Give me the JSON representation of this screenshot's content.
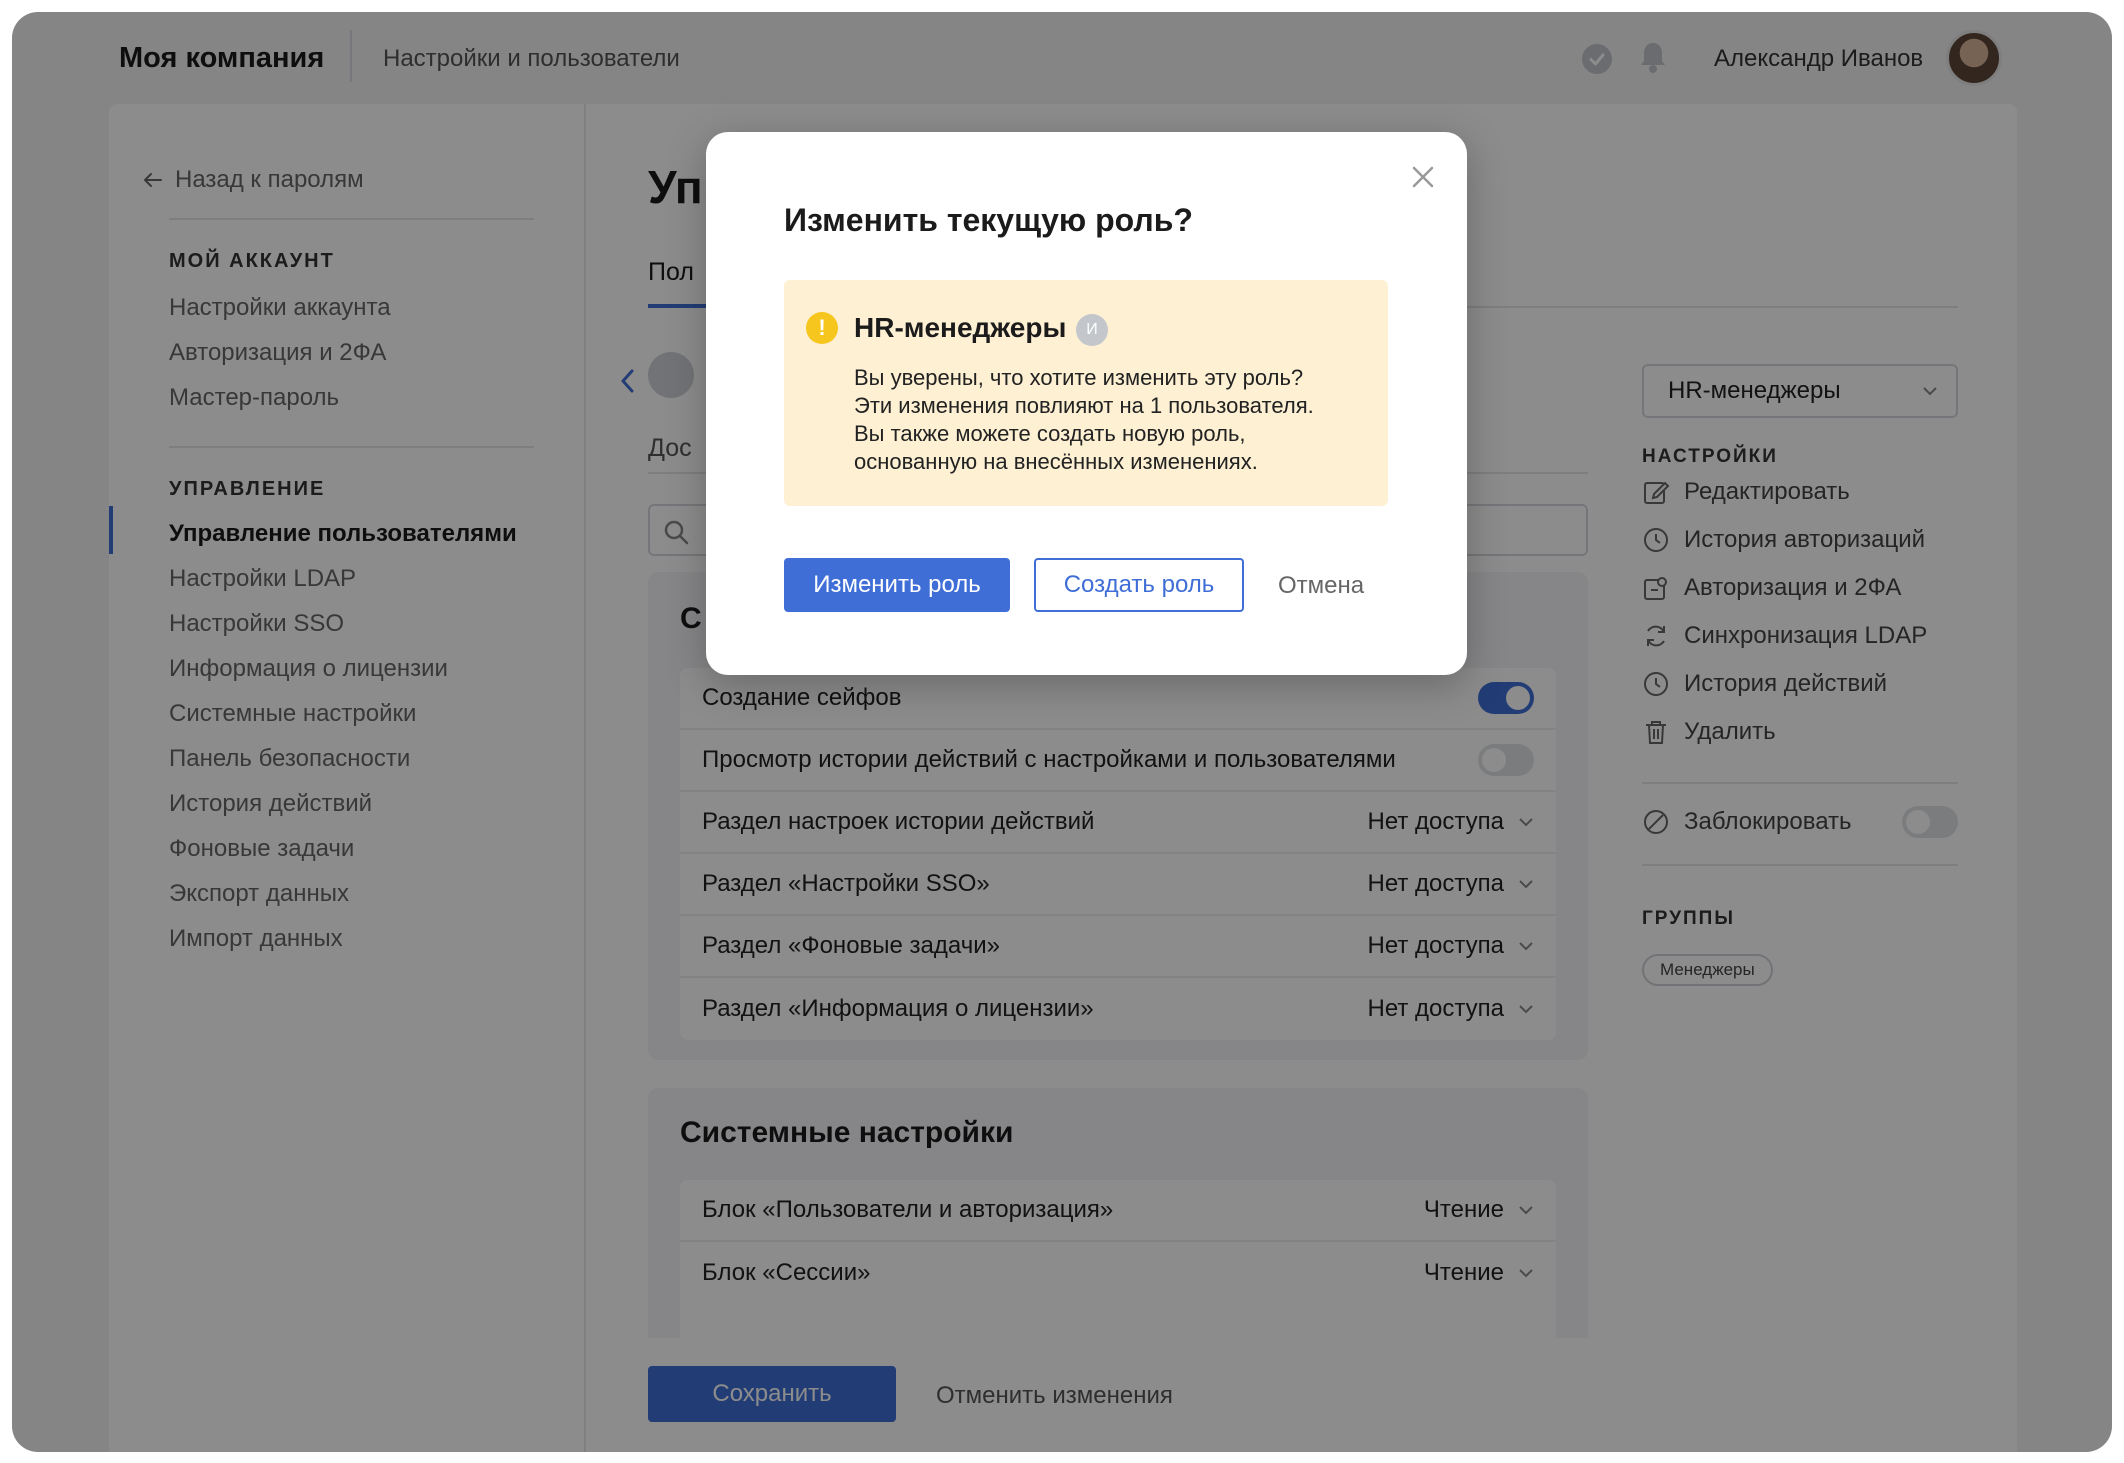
{
  "topbar": {
    "company": "Моя компания",
    "section": "Настройки и пользователи",
    "user_name": "Александр Иванов"
  },
  "sidebar": {
    "back_label": "Назад к паролям",
    "account_heading": "МОЙ АККАУНТ",
    "account_items": [
      {
        "label": "Настройки аккаунта"
      },
      {
        "label": "Авторизация и 2ФА"
      },
      {
        "label": "Мастер-пароль"
      }
    ],
    "management_heading": "УПРАВЛЕНИЕ",
    "management_items": [
      {
        "label": "Управление пользователями",
        "active": true
      },
      {
        "label": "Настройки LDAP"
      },
      {
        "label": "Настройки SSO"
      },
      {
        "label": "Информация о лицензии"
      },
      {
        "label": "Системные настройки"
      },
      {
        "label": "Панель безопасности"
      },
      {
        "label": "История действий"
      },
      {
        "label": "Фоновые задачи"
      },
      {
        "label": "Экспорт данных"
      },
      {
        "label": "Импорт данных"
      }
    ]
  },
  "main": {
    "page_title_fragment": "Уп",
    "tab_fragment": "Пол",
    "doc_fragment": "Дос",
    "section1_title_fragment": "С",
    "section1_rows": [
      {
        "label": "Создание сейфов",
        "toggle": "on"
      },
      {
        "label": "Просмотр истории действий с настройками и пользователями",
        "toggle": "off"
      },
      {
        "label": "Раздел настроек истории действий",
        "value": "Нет доступа"
      },
      {
        "label": "Раздел «Настройки SSO»",
        "value": "Нет доступа"
      },
      {
        "label": "Раздел «Фоновые задачи»",
        "value": "Нет доступа"
      },
      {
        "label": "Раздел «Информация о лицензии»",
        "value": "Нет доступа"
      }
    ],
    "section2_title": "Системные настройки",
    "section2_rows": [
      {
        "label": "Блок «Пользователи и авторизация»",
        "value": "Чтение"
      },
      {
        "label": "Блок «Сессии»",
        "value": "Чтение"
      }
    ],
    "save_label": "Сохранить",
    "discard_label": "Отменить изменения"
  },
  "right_panel": {
    "role_select_value": "HR-менеджеры",
    "settings_heading": "НАСТРОЙКИ",
    "actions": [
      {
        "label": "Редактировать",
        "icon": "edit-icon"
      },
      {
        "label": "История авторизаций",
        "icon": "clock-icon"
      },
      {
        "label": "Авторизация и 2ФА",
        "icon": "key-icon"
      },
      {
        "label": "Синхронизация LDAP",
        "icon": "sync-icon"
      },
      {
        "label": "История действий",
        "icon": "clock-icon"
      },
      {
        "label": "Удалить",
        "icon": "trash-icon"
      }
    ],
    "block_label": "Заблокировать",
    "groups_heading": "ГРУППЫ",
    "group_chip": "Менеджеры"
  },
  "modal": {
    "title": "Изменить текущую роль?",
    "warning_title": "HR-менеджеры",
    "warning_badge": "И",
    "warning_lines": [
      "Вы уверены, что хотите изменить эту роль?",
      "Эти изменения повлияют на 1 пользователя.",
      "Вы также можете создать новую роль,",
      "основанную на внесённых изменениях."
    ],
    "primary_button": "Изменить роль",
    "secondary_button": "Создать роль",
    "cancel_button": "Отмена"
  },
  "colors": {
    "accent": "#3f6fd6",
    "warning_bg": "#fdf0d3",
    "warning_icon": "#f7c61e"
  }
}
